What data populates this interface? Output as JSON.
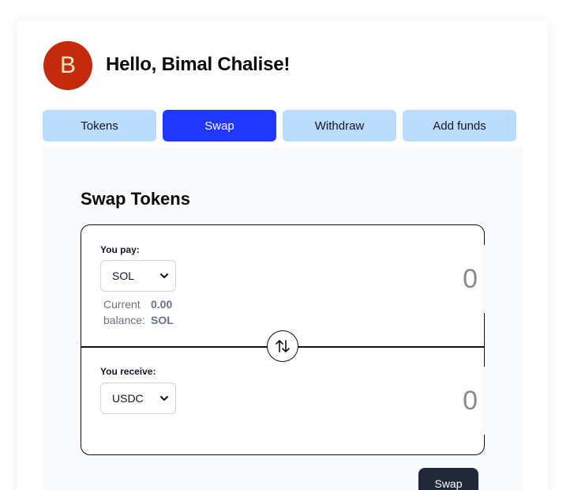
{
  "header": {
    "avatar_initial": "B",
    "greeting": "Hello, Bimal Chalise!"
  },
  "tabs": [
    {
      "label": "Tokens",
      "active": false
    },
    {
      "label": "Swap",
      "active": true
    },
    {
      "label": "Withdraw",
      "active": false
    },
    {
      "label": "Add funds",
      "active": false
    }
  ],
  "swap": {
    "title": "Swap Tokens",
    "pay": {
      "label": "You pay:",
      "token": "SOL",
      "amount": "0",
      "balance_label_line1": "Current",
      "balance_label_line2": "balance:",
      "balance_value_line1": "0.00",
      "balance_value_line2": "SOL"
    },
    "receive": {
      "label": "You receive:",
      "token": "USDC",
      "amount": "0"
    },
    "button_label": "Swap"
  },
  "icons": {
    "toggle": "swap-vertical-arrows-icon",
    "select": "chevron-down-icon"
  },
  "colors": {
    "primary": "#2138ff",
    "tab_inactive": "#bcdcfd",
    "avatar": "#c42a0c",
    "button_dark": "#1f2937"
  }
}
